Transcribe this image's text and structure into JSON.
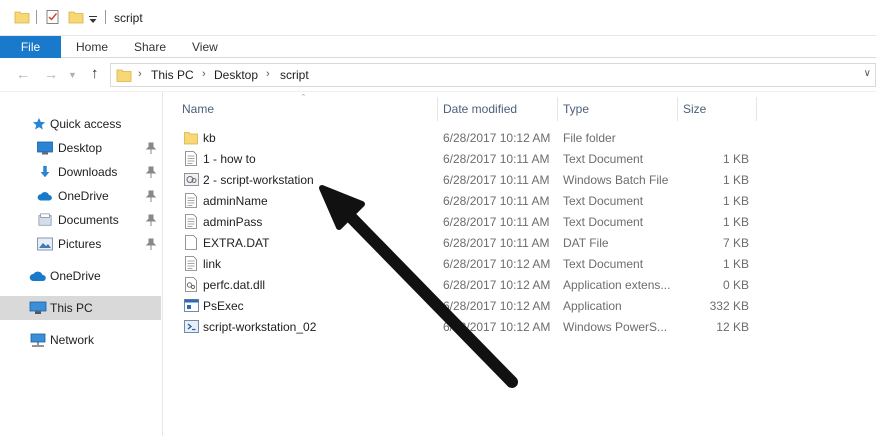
{
  "window": {
    "title": "script"
  },
  "ribbon": {
    "tabs": [
      "File",
      "Home",
      "Share",
      "View"
    ]
  },
  "address": {
    "breadcrumbs": [
      "This PC",
      "Desktop",
      "script"
    ]
  },
  "nav": {
    "quick_access": "Quick access",
    "items": [
      {
        "label": "Desktop",
        "pinned": true
      },
      {
        "label": "Downloads",
        "pinned": true
      },
      {
        "label": "OneDrive",
        "pinned": true
      },
      {
        "label": "Documents",
        "pinned": true
      },
      {
        "label": "Pictures",
        "pinned": true
      }
    ],
    "onedrive": "OneDrive",
    "this_pc": "This PC",
    "network": "Network"
  },
  "columns": {
    "name": "Name",
    "date": "Date modified",
    "type": "Type",
    "size": "Size"
  },
  "files": [
    {
      "name": "kb",
      "date": "6/28/2017 10:12 AM",
      "type": "File folder",
      "size": "",
      "icon": "folder-icon"
    },
    {
      "name": "1 - how to",
      "date": "6/28/2017 10:11 AM",
      "type": "Text Document",
      "size": "1 KB",
      "icon": "text-file-icon"
    },
    {
      "name": "2 - script-workstation",
      "date": "6/28/2017 10:11 AM",
      "type": "Windows Batch File",
      "size": "1 KB",
      "icon": "batch-file-icon"
    },
    {
      "name": "adminName",
      "date": "6/28/2017 10:11 AM",
      "type": "Text Document",
      "size": "1 KB",
      "icon": "text-file-icon"
    },
    {
      "name": "adminPass",
      "date": "6/28/2017 10:11 AM",
      "type": "Text Document",
      "size": "1 KB",
      "icon": "text-file-icon"
    },
    {
      "name": "EXTRA.DAT",
      "date": "6/28/2017 10:11 AM",
      "type": "DAT File",
      "size": "7 KB",
      "icon": "blank-file-icon"
    },
    {
      "name": "link",
      "date": "6/28/2017 10:12 AM",
      "type": "Text Document",
      "size": "1 KB",
      "icon": "text-file-icon"
    },
    {
      "name": "perfc.dat.dll",
      "date": "6/28/2017 10:12 AM",
      "type": "Application extens...",
      "size": "0 KB",
      "icon": "dll-file-icon"
    },
    {
      "name": "PsExec",
      "date": "6/28/2017 10:12 AM",
      "type": "Application",
      "size": "332 KB",
      "icon": "exe-file-icon"
    },
    {
      "name": "script-workstation_02",
      "date": "6/28/2017 10:12 AM",
      "type": "Windows PowerS...",
      "size": "12 KB",
      "icon": "powershell-file-icon"
    }
  ],
  "colors": {
    "accent": "#1979ca",
    "selected_nav": "#d9d9d9",
    "folder": "#f8d775"
  }
}
